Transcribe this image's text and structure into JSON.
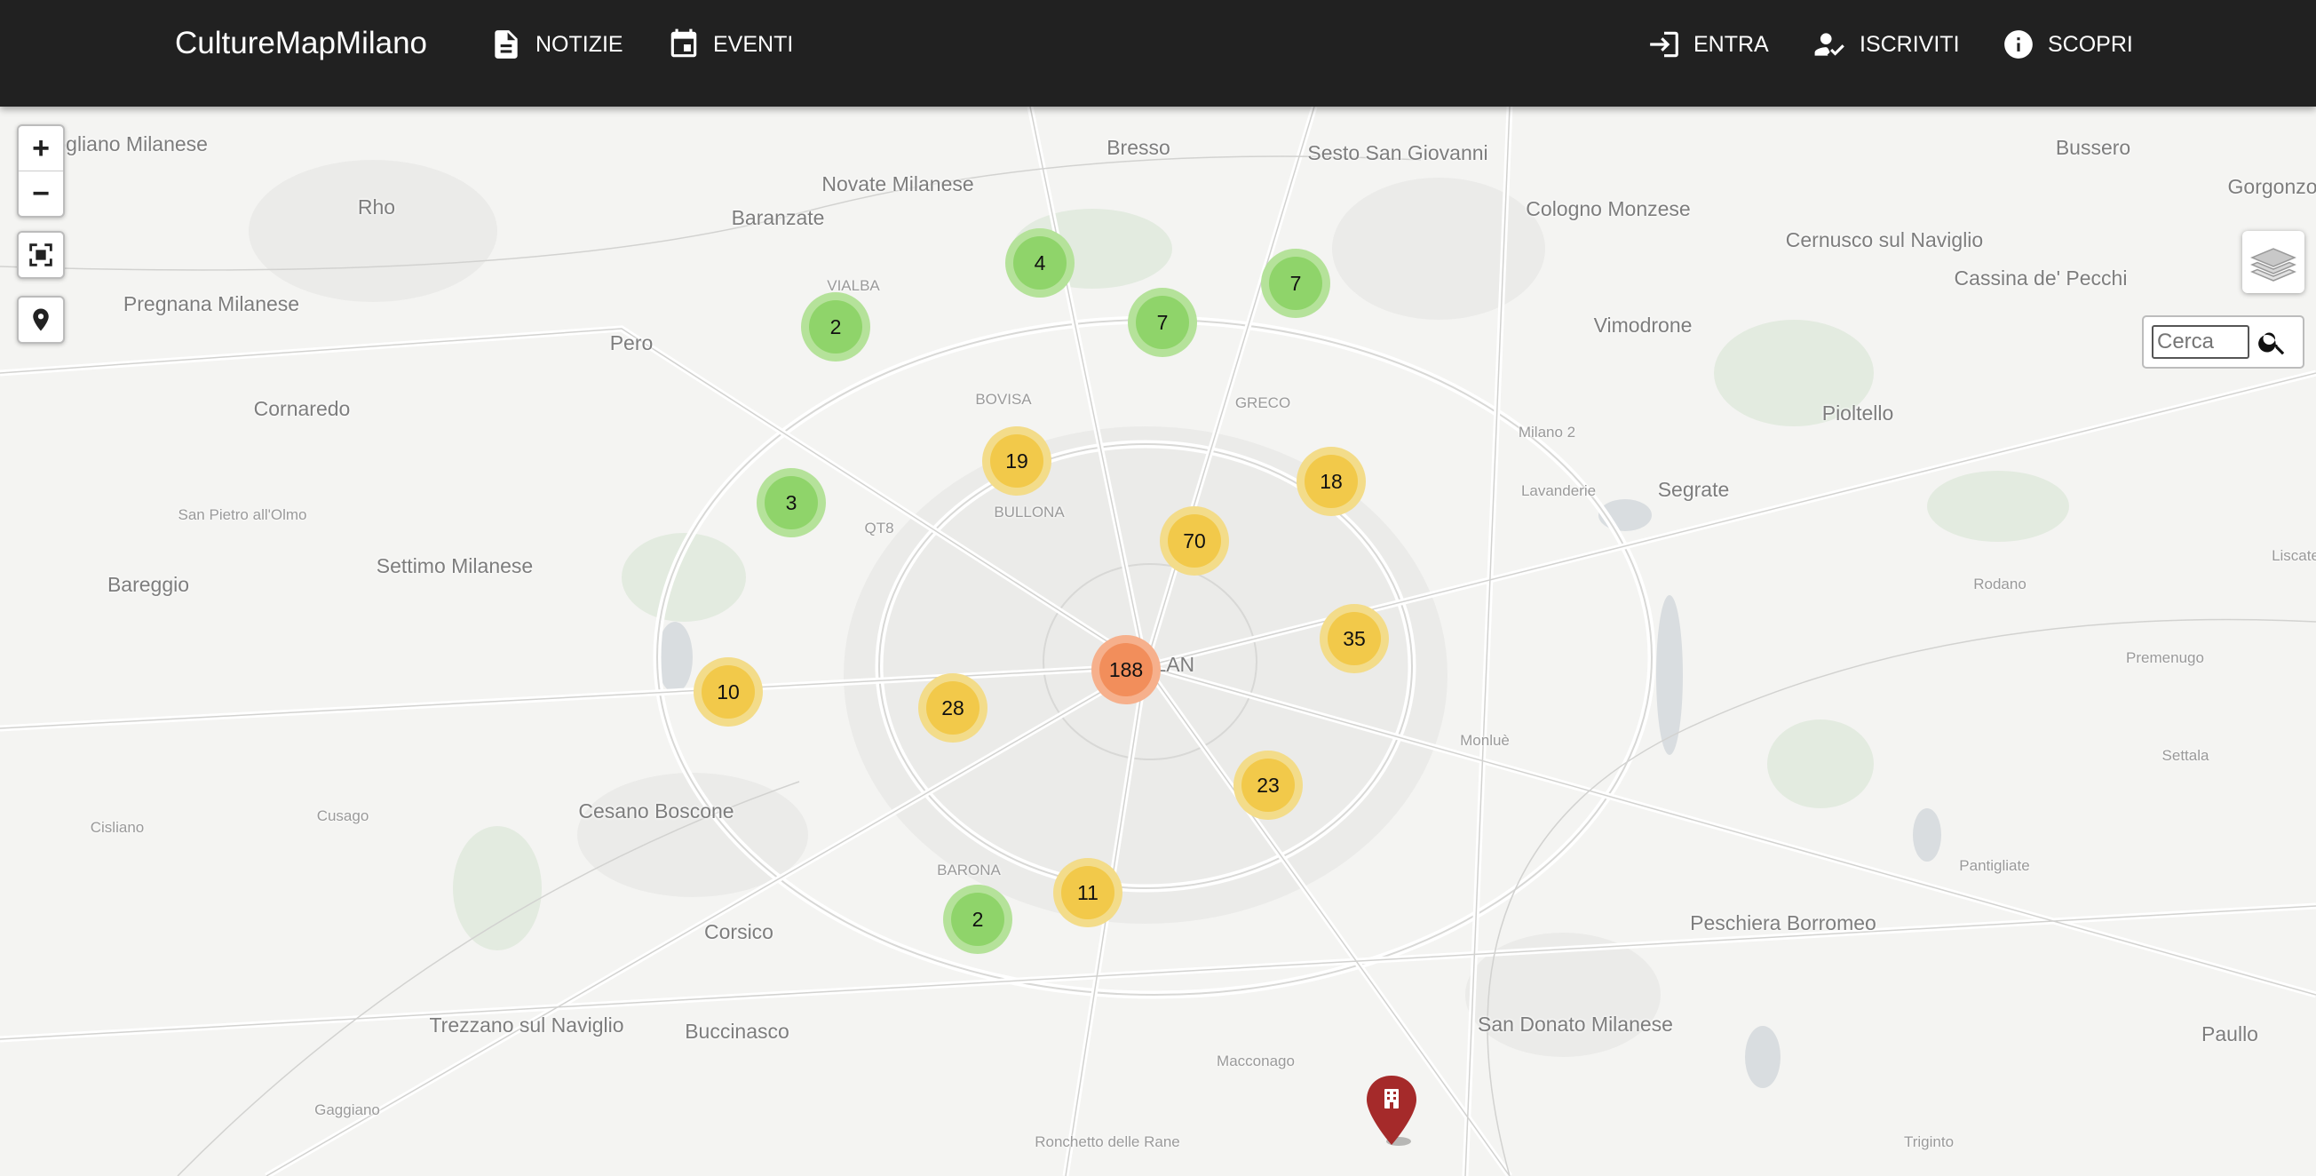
{
  "brand": "CultureMapMilano",
  "nav": {
    "notizie": "NOTIZIE",
    "eventi": "EVENTI",
    "entra": "ENTRA",
    "iscriviti": "ISCRIVITI",
    "scopri": "SCOPRI"
  },
  "map_controls": {
    "zoom_in": "+",
    "zoom_out": "−"
  },
  "search": {
    "placeholder": "Cerca"
  },
  "places": [
    "Pogliano Milanese",
    "Bresso",
    "Sesto San Giovanni",
    "Bussero",
    "Gorgonzola",
    "Novate Milanese",
    "Rho",
    "Baranzate",
    "Cologno Monzese",
    "Cernusco sul Naviglio",
    "Cassina de' Pecchi",
    "Pregnana Milanese",
    "VIALBA",
    "Vimodrone",
    "Pero",
    "Cornaredo",
    "BOVISA",
    "GRECO",
    "Milano 2",
    "Pioltello",
    "Segrate",
    "Lavanderie",
    "San Pietro all'Olmo",
    "BULLONA",
    "QT8",
    "Settimo Milanese",
    "Bareggio",
    "Liscate",
    "Rodano",
    "MILAN",
    "Premenugo",
    "Monluè",
    "Settala",
    "Cisliano",
    "Cusago",
    "Cesano Boscone",
    "BARONA",
    "Pantigliate",
    "Corsico",
    "Peschiera Borromeo",
    "Trezzano sul Naviglio",
    "Buccinasco",
    "San Donato Milanese",
    "Paullo",
    "Macconago",
    "Gaggiano",
    "Ronchetto delle Rane",
    "Triginto"
  ],
  "clusters": [
    {
      "count": "4",
      "level": "low"
    },
    {
      "count": "7",
      "level": "low"
    },
    {
      "count": "2",
      "level": "low"
    },
    {
      "count": "7",
      "level": "low"
    },
    {
      "count": "19",
      "level": "mid"
    },
    {
      "count": "18",
      "level": "mid"
    },
    {
      "count": "3",
      "level": "low"
    },
    {
      "count": "70",
      "level": "mid"
    },
    {
      "count": "35",
      "level": "mid"
    },
    {
      "count": "188",
      "level": "high"
    },
    {
      "count": "10",
      "level": "mid"
    },
    {
      "count": "28",
      "level": "mid"
    },
    {
      "count": "23",
      "level": "mid"
    },
    {
      "count": "11",
      "level": "mid"
    },
    {
      "count": "2",
      "level": "low"
    }
  ],
  "cluster_colors": {
    "low": {
      "outer": "#b5e29a",
      "inner": "#8fd46a"
    },
    "mid": {
      "outer": "#f3dc8a",
      "inner": "#f2c94a"
    },
    "high": {
      "outer": "#f6b08c",
      "inner": "#f28e5b"
    }
  },
  "marker": {
    "icon": "building-icon",
    "color": "#a52a2a"
  }
}
